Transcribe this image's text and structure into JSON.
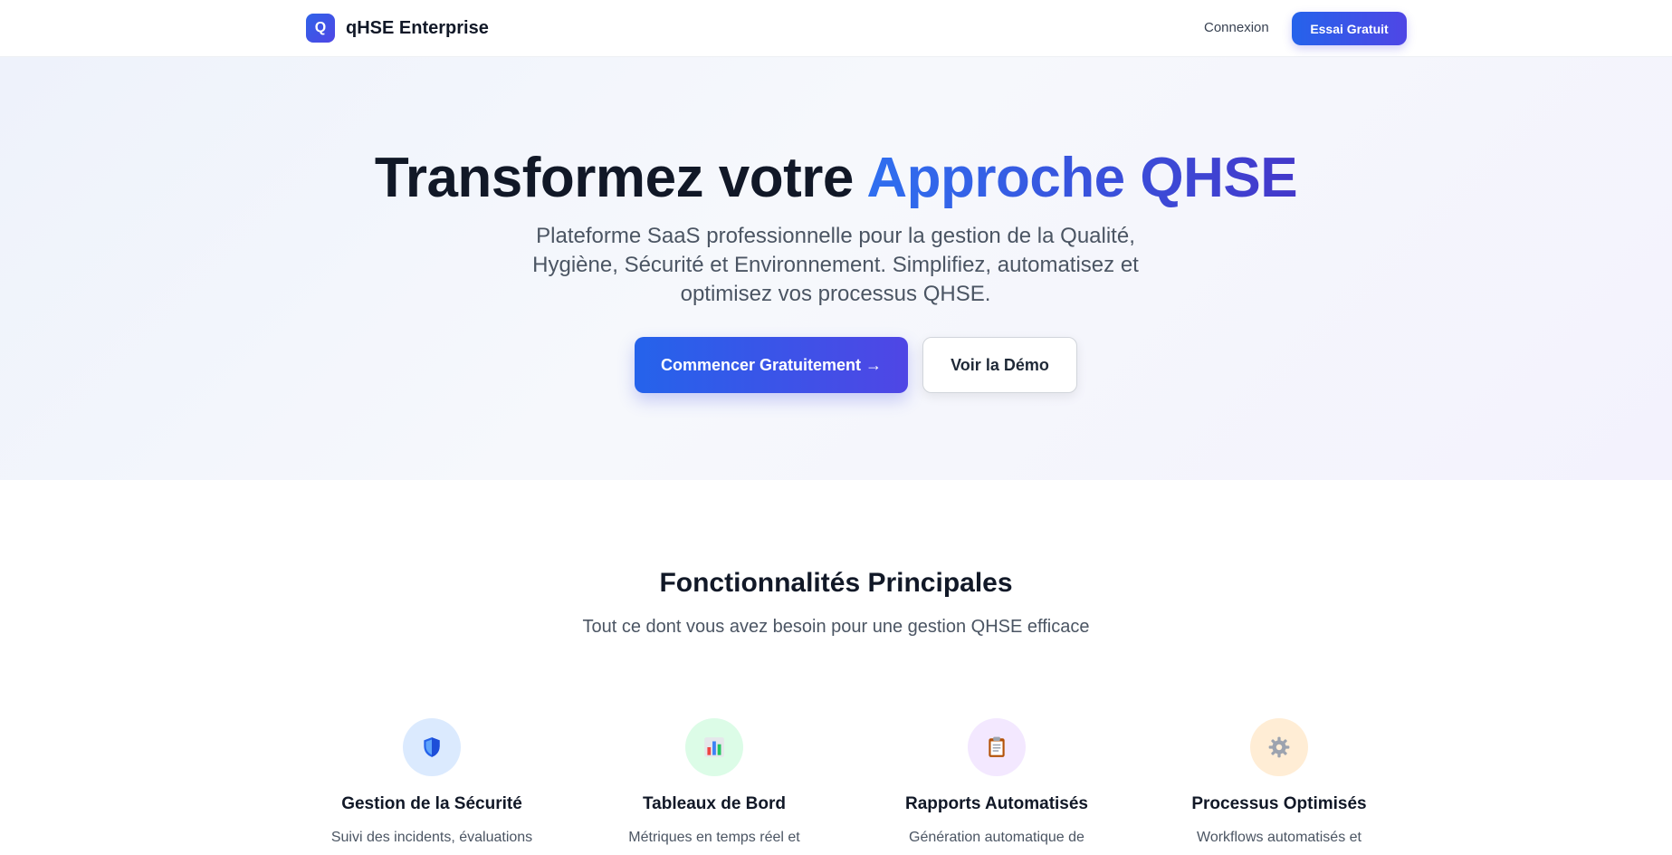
{
  "nav": {
    "logo_letter": "Q",
    "brand": "qHSE Enterprise",
    "login": "Connexion",
    "cta": "Essai Gratuit"
  },
  "hero": {
    "title_main": "Transformez votre ",
    "title_accent": "Approche QHSE",
    "subtitle": "Plateforme SaaS professionnelle pour la gestion de la Qualité, Hygiène, Sécurité et Environnement. Simplifiez, automatisez et optimisez vos processus QHSE.",
    "primary_button": "Commencer Gratuitement →",
    "secondary_button": "Voir la Démo"
  },
  "features": {
    "title": "Fonctionnalités Principales",
    "subtitle": "Tout ce dont vous avez besoin pour une gestion QHSE efficace",
    "items": [
      {
        "icon": "shield-icon",
        "title": "Gestion de la Sécurité",
        "desc": "Suivi des incidents, évaluations"
      },
      {
        "icon": "bar-chart-icon",
        "title": "Tableaux de Bord",
        "desc": "Métriques en temps réel et"
      },
      {
        "icon": "clipboard-icon",
        "title": "Rapports Automatisés",
        "desc": "Génération automatique de"
      },
      {
        "icon": "gear-icon",
        "title": "Processus Optimisés",
        "desc": "Workflows automatisés et"
      }
    ]
  },
  "colors": {
    "accent": "#2563eb",
    "accent_end": "#4f46e5"
  }
}
